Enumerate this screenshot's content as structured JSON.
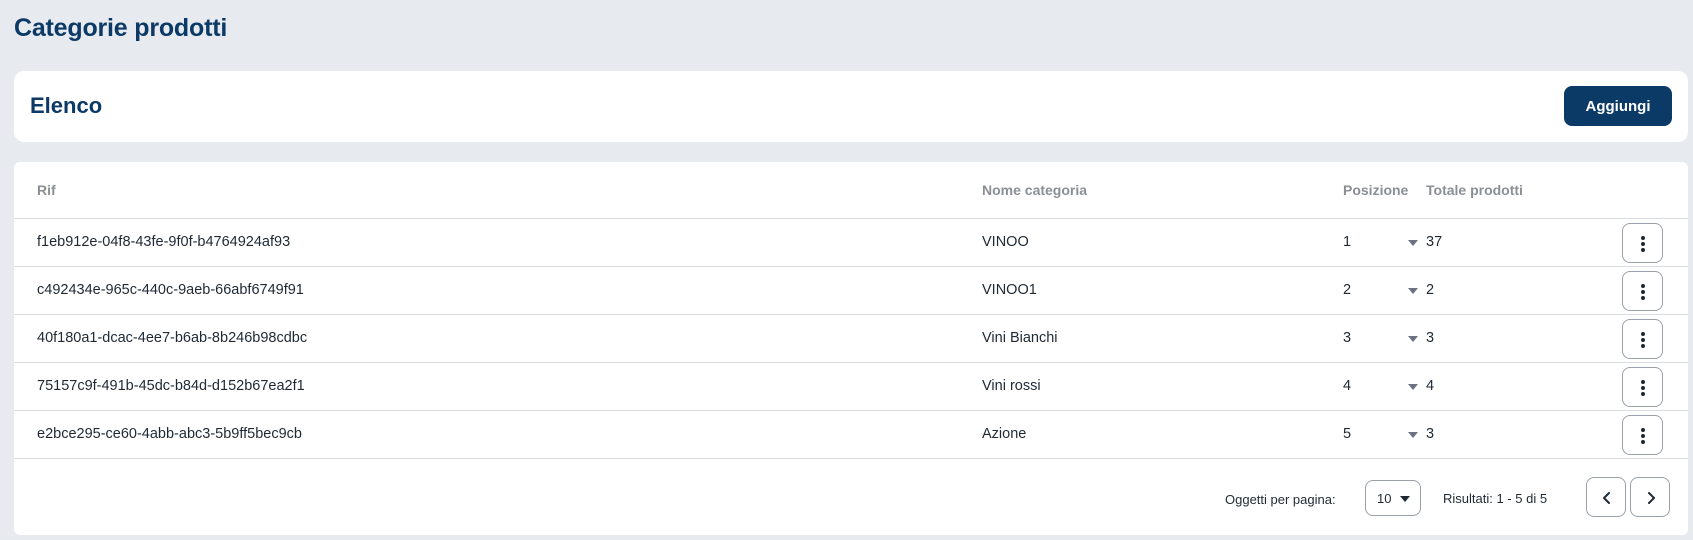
{
  "page": {
    "title": "Categorie prodotti"
  },
  "header": {
    "section_title": "Elenco",
    "add_label": "Aggiungi"
  },
  "table": {
    "columns": {
      "rif": "Rif",
      "nome": "Nome categoria",
      "posizione": "Posizione",
      "totale": "Totale prodotti"
    },
    "rows": [
      {
        "rif": "f1eb912e-04f8-43fe-9f0f-b4764924af93",
        "nome": "VINOO",
        "posizione": "1",
        "totale": "37"
      },
      {
        "rif": "c492434e-965c-440c-9aeb-66abf6749f91",
        "nome": "VINOO1",
        "posizione": "2",
        "totale": "2"
      },
      {
        "rif": "40f180a1-dcac-4ee7-b6ab-8b246b98cdbc",
        "nome": "Vini Bianchi",
        "posizione": "3",
        "totale": "3"
      },
      {
        "rif": "75157c9f-491b-45dc-b84d-d152b67ea2f1",
        "nome": "Vini rossi",
        "posizione": "4",
        "totale": "4"
      },
      {
        "rif": "e2bce295-ce60-4abb-abc3-5b9ff5bec9cb",
        "nome": "Azione",
        "posizione": "5",
        "totale": "3"
      }
    ]
  },
  "footer": {
    "per_page_label": "Oggetti per pagina:",
    "per_page_value": "10",
    "results_text": "Risultati: 1 - 5 di 5"
  },
  "icons": {
    "row_menu": "kebab-menu-icon",
    "position_dropdown": "caret-down-icon",
    "prev": "chevron-left-icon",
    "next": "chevron-right-icon"
  },
  "colors": {
    "primary": "#0c3a66",
    "background": "#e7ebef",
    "card": "#ffffff",
    "header_text": "#8b8f94",
    "border": "#d9dde1"
  }
}
